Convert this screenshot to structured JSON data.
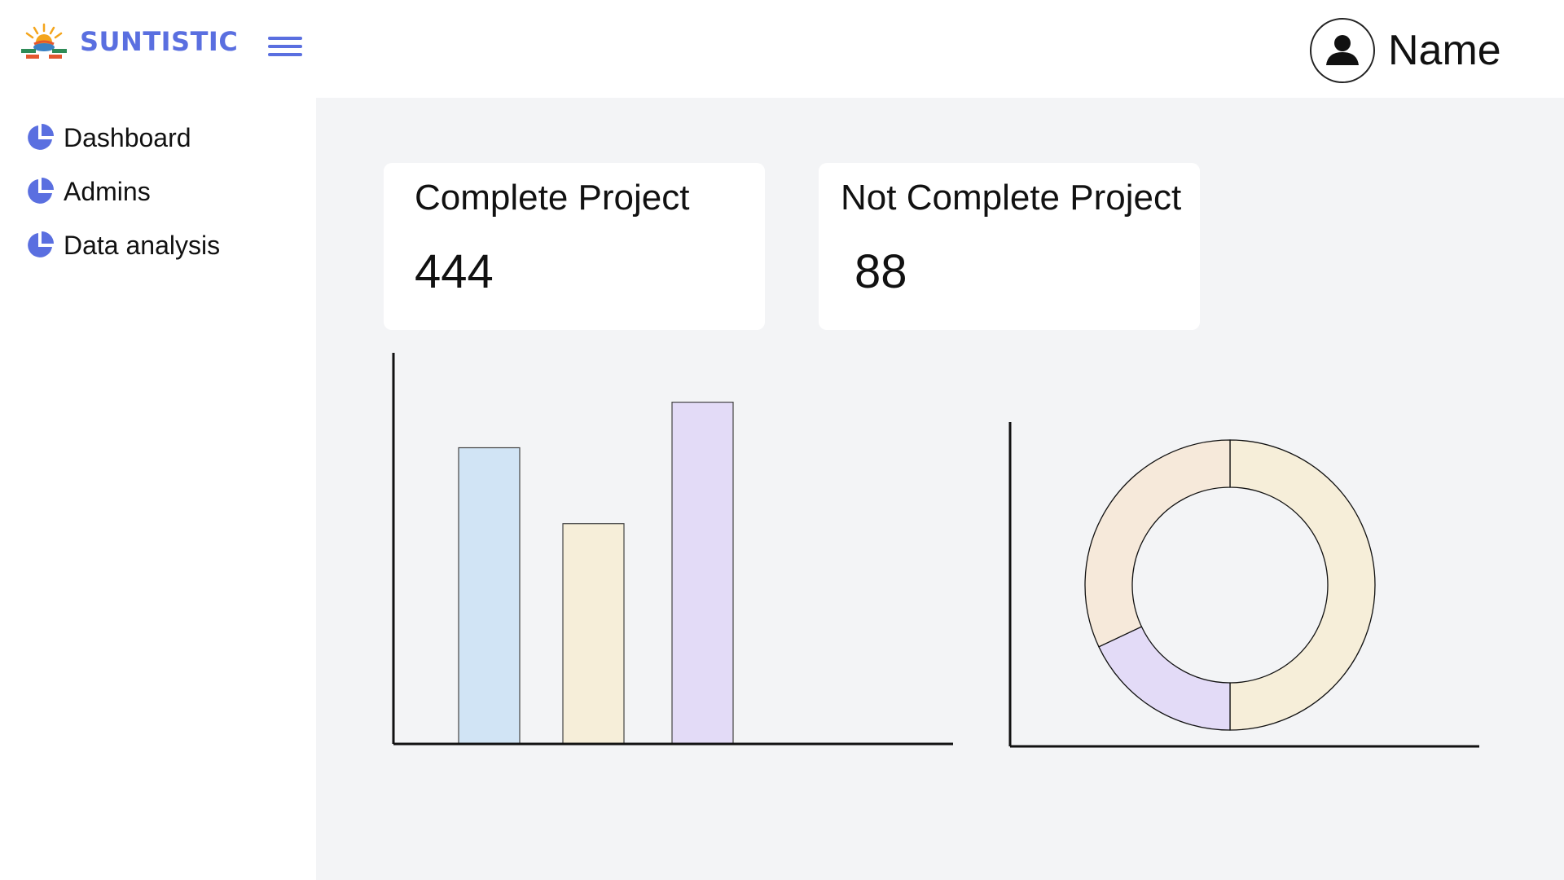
{
  "header": {
    "brand_name": "SUNTISTIC",
    "logo_icon": "sun-logo-icon",
    "menu_icon": "hamburger-menu-icon",
    "user": {
      "name": "Name",
      "avatar_icon": "user-avatar-icon"
    }
  },
  "sidebar": {
    "items": [
      {
        "label": "Dashboard",
        "icon": "pie-chart-icon"
      },
      {
        "label": "Admins",
        "icon": "pie-chart-icon"
      },
      {
        "label": "Data analysis",
        "icon": "pie-chart-icon"
      }
    ]
  },
  "cards": [
    {
      "title": "Complete Project",
      "value": "444"
    },
    {
      "title": "Not Complete Project",
      "value": "88"
    }
  ],
  "colors": {
    "accent": "#5a6fe0",
    "content_bg": "#f3f4f6",
    "blue": "#d1e4f5",
    "cream": "#f6eed9",
    "lavender": "#e3dbf7",
    "peach": "#f6e9da"
  },
  "chart_data": [
    {
      "type": "bar",
      "categories": [
        "",
        "",
        ""
      ],
      "values": [
        78,
        58,
        90
      ],
      "colors": [
        "#d1e4f5",
        "#f6eed9",
        "#e3dbf7"
      ],
      "ylim": [
        0,
        103
      ],
      "grid": false,
      "legend": "none"
    },
    {
      "type": "pie",
      "donut": true,
      "values": [
        50,
        18,
        32
      ],
      "colors": [
        "#f6eed9",
        "#e3dbf7",
        "#f6e9da"
      ],
      "legend": "none"
    }
  ]
}
